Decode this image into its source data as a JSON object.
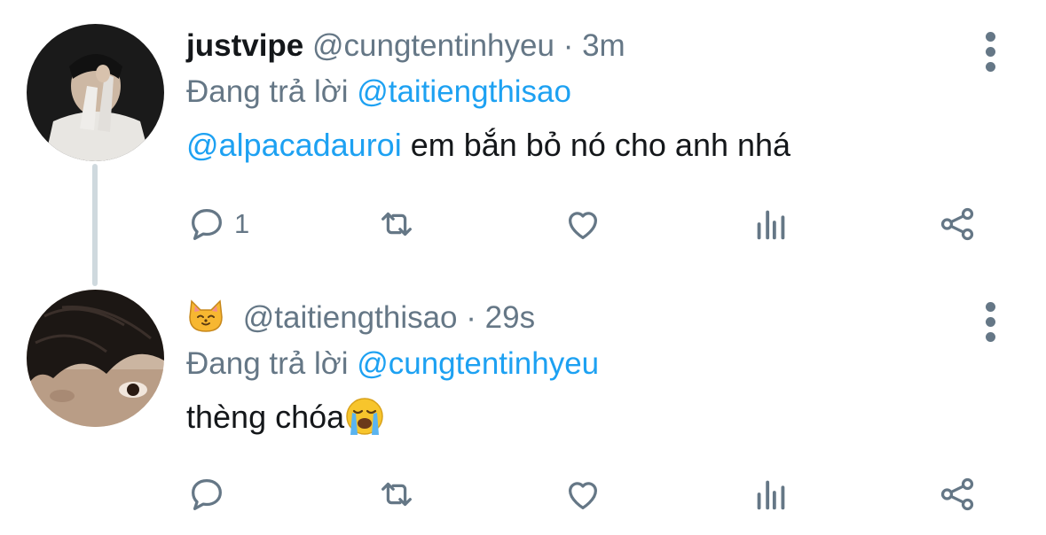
{
  "tweets": [
    {
      "display_name": "justvipe",
      "handle": "@cungtentinhyeu",
      "separator": "·",
      "time": "3m",
      "reply_prefix": "Đang trả lời",
      "reply_to": "@taitiengthisao",
      "mention": "@alpacadauroi",
      "text": " em bắn bỏ nó cho anh nhá",
      "reply_count": "1"
    },
    {
      "display_name_icon": "cat-face-emoji",
      "handle": "@taitiengthisao",
      "separator": "·",
      "time": "29s",
      "reply_prefix": "Đang trả lời",
      "reply_to": "@cungtentinhyeu",
      "text": "thèng chóa",
      "text_emoji": "loudly-crying-face-emoji",
      "reply_count": ""
    }
  ],
  "actions": [
    "reply-icon",
    "retweet-icon",
    "like-icon",
    "analytics-icon",
    "share-icon"
  ],
  "colors": {
    "link": "#1da1f2",
    "muted": "#657786",
    "text": "#14171a",
    "thread": "#cfd9de"
  }
}
